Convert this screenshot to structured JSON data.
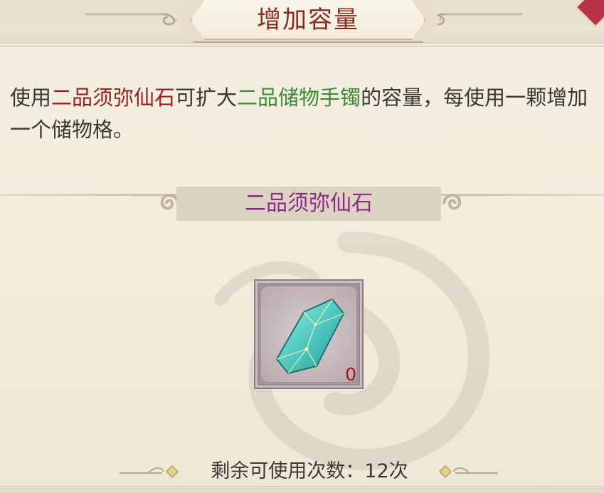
{
  "title": "增加容量",
  "description": {
    "part1": "使用",
    "item_name": "二品须弥仙石",
    "part2": "可扩大",
    "target_name": "二品储物手镯",
    "part3": "的容量，每使用一颗增加一个储物格。"
  },
  "subtitle": "二品须弥仙石",
  "item": {
    "icon": "jade-crystal-icon",
    "count": "0"
  },
  "footer": {
    "remaining_text": "剩余可使用次数：12次"
  },
  "colors": {
    "title": "#8a2b22",
    "item_name": "#9a1f1f",
    "target_name": "#3d8a35",
    "subtitle": "#8e2b86",
    "count": "#a01818"
  }
}
